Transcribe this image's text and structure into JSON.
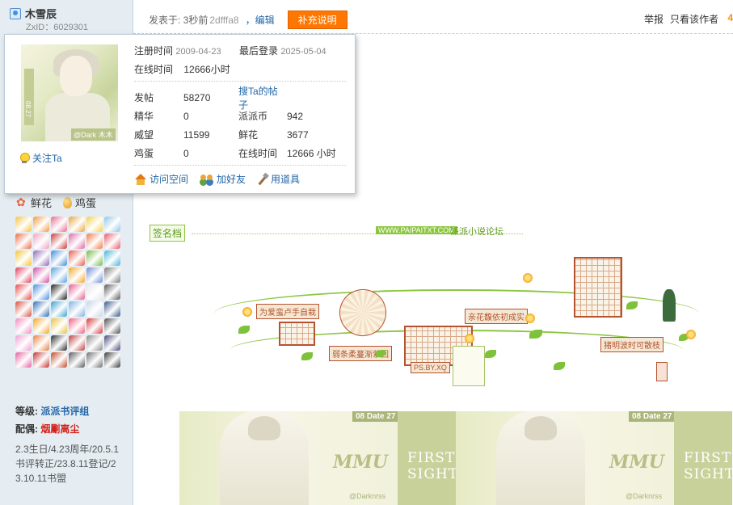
{
  "user": {
    "name": "木雪辰",
    "zxid": "ZxID：6029301"
  },
  "post_header": {
    "posted_label": "发表于: 3秒前",
    "time_suffix": "2dfffa8",
    "edit_label": "，编辑",
    "supplement_button": "补充说明",
    "report_label": "举报",
    "author_only_label": "只看该作者",
    "edge_char": "4"
  },
  "card": {
    "reg_label": "注册时间",
    "reg_value": "2009-04-23",
    "last_login_label": "最后登录",
    "last_login_value": "2025-05-04",
    "online_label": "在线时间",
    "online_value": "12666小时",
    "avatar_tag": "@Dark 木木",
    "avatar_date": "08.27",
    "follow_label": "关注Ta",
    "stats": [
      {
        "label": "发帖",
        "value": "58270",
        "label2": "搜Ta的帖子",
        "value2": ""
      },
      {
        "label": "精华",
        "value": "0",
        "label2": "派派币",
        "value2": "942"
      },
      {
        "label": "威望",
        "value": "11599",
        "label2": "鲜花",
        "value2": "3677"
      },
      {
        "label": "鸡蛋",
        "value": "0",
        "label2": "在线时间",
        "value2": "12666 小时"
      }
    ],
    "actions": {
      "visit": "访问空间",
      "add_friend": "加好友",
      "use_tool": "用道具"
    }
  },
  "sidebar": {
    "flower_label": "鲜花",
    "egg_label": "鸡蛋",
    "level_label": "等级:",
    "level_value": "派派书评组",
    "mate_label": "配偶:",
    "mate_value": "烟劚离尘",
    "description": "2.3生日/4.23周年/20.5.1书评转正/23.8.11登记/23.10.11书盟",
    "medal_colors": [
      "#f6c244",
      "#f39a3c",
      "#e86d8f",
      "#e8a63b",
      "#f2d24a",
      "#8fc5e8",
      "#e86d4a",
      "#f2a0c2",
      "#c73a3a",
      "#d96ba8",
      "#f07b46",
      "#e85b6b",
      "#f5c330",
      "#8e6ab8",
      "#3d8bd9",
      "#e85b4a",
      "#7ab94a",
      "#4ab5d9",
      "#e04060",
      "#d44fa0",
      "#5aa0e0",
      "#f5a623",
      "#6c8ad6",
      "#7a7a7a",
      "#e84a4a",
      "#4a90e2",
      "#222222",
      "#e85b8f",
      "#e8e8f0",
      "#5a5a5a",
      "#d9503f",
      "#2f6fb8",
      "#3aa0d0",
      "#7fb0e0",
      "#c9d6e8",
      "#3a5a8a",
      "#f08cc0",
      "#f6a623",
      "#e8c040",
      "#f06080",
      "#d93a3a",
      "#505050",
      "#f0a0d0",
      "#e88040",
      "#2d2d2d",
      "#c04040",
      "#8a8a8a",
      "#4a4a7a",
      "#e860a0",
      "#c83030",
      "#c04a2a",
      "#5a5a5a",
      "#707070",
      "#3a3a3a"
    ]
  },
  "signature": {
    "tag_label": "签名档",
    "url_label": "WWW.PAIPAITXT.COM",
    "forum_label": "派派小说论坛",
    "planks": [
      "为爱蛮卢手自栽",
      "弱条柔蔓渐萦回",
      "亲花馥依初成实",
      "猪明波时可散枝",
      "PS.BY.XQ"
    ],
    "banner_title": "MMU",
    "banner_date": "08 Date 27",
    "banner_name": "@Darknrss",
    "banner_first": "FIRST",
    "banner_sight": "SIGHT"
  }
}
